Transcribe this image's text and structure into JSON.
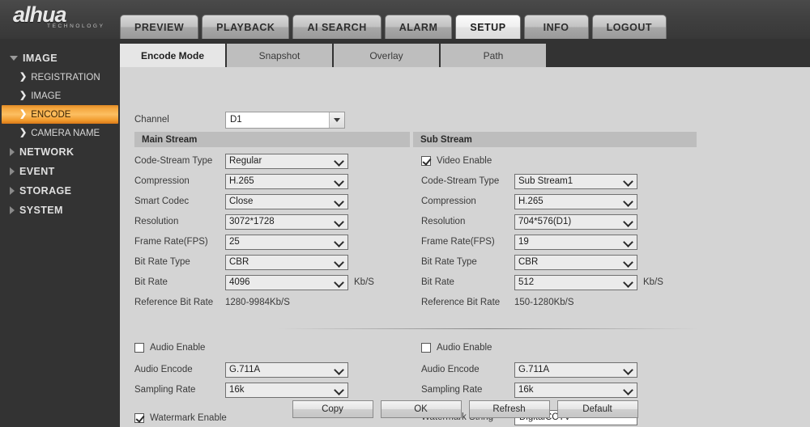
{
  "brand": {
    "name": "alhua",
    "tagline": "TECHNOLOGY"
  },
  "nav": {
    "tabs": [
      {
        "label": "PREVIEW",
        "active": false
      },
      {
        "label": "PLAYBACK",
        "active": false
      },
      {
        "label": "AI SEARCH",
        "active": false
      },
      {
        "label": "ALARM",
        "active": false
      },
      {
        "label": "SETUP",
        "active": true
      },
      {
        "label": "INFO",
        "active": false
      },
      {
        "label": "LOGOUT",
        "active": false
      }
    ]
  },
  "sidebar": {
    "items": [
      {
        "label": "IMAGE",
        "type": "group",
        "expanded": true
      },
      {
        "label": "REGISTRATION",
        "type": "sub",
        "selected": false
      },
      {
        "label": "IMAGE",
        "type": "sub",
        "selected": false
      },
      {
        "label": "ENCODE",
        "type": "sub",
        "selected": true
      },
      {
        "label": "CAMERA NAME",
        "type": "sub",
        "selected": false
      },
      {
        "label": "NETWORK",
        "type": "group",
        "expanded": false
      },
      {
        "label": "EVENT",
        "type": "group",
        "expanded": false
      },
      {
        "label": "STORAGE",
        "type": "group",
        "expanded": false
      },
      {
        "label": "SYSTEM",
        "type": "group",
        "expanded": false
      }
    ]
  },
  "subtabs": [
    {
      "label": "Encode Mode",
      "active": true
    },
    {
      "label": "Snapshot",
      "active": false
    },
    {
      "label": "Overlay",
      "active": false
    },
    {
      "label": "Path",
      "active": false
    }
  ],
  "channel": {
    "label": "Channel",
    "value": "D1"
  },
  "main_stream": {
    "header": "Main Stream",
    "code_stream_type": {
      "label": "Code-Stream Type",
      "value": "Regular"
    },
    "compression": {
      "label": "Compression",
      "value": "H.265"
    },
    "smart_codec": {
      "label": "Smart Codec",
      "value": "Close"
    },
    "resolution": {
      "label": "Resolution",
      "value": "3072*1728"
    },
    "frame_rate": {
      "label": "Frame Rate(FPS)",
      "value": "25"
    },
    "bit_rate_type": {
      "label": "Bit Rate Type",
      "value": "CBR"
    },
    "bit_rate": {
      "label": "Bit Rate",
      "value": "4096",
      "unit": "Kb/S"
    },
    "reference_bit_rate": {
      "label": "Reference Bit Rate",
      "value": "1280-9984Kb/S"
    },
    "audio_enable": {
      "label": "Audio Enable",
      "checked": false
    },
    "audio_encode": {
      "label": "Audio Encode",
      "value": "G.711A"
    },
    "sampling_rate": {
      "label": "Sampling Rate",
      "value": "16k"
    },
    "watermark_enable": {
      "label": "Watermark Enable",
      "checked": true
    }
  },
  "sub_stream": {
    "header": "Sub Stream",
    "video_enable": {
      "label": "Video Enable",
      "checked": true
    },
    "code_stream_type": {
      "label": "Code-Stream Type",
      "value": "Sub Stream1"
    },
    "compression": {
      "label": "Compression",
      "value": "H.265"
    },
    "resolution": {
      "label": "Resolution",
      "value": "704*576(D1)"
    },
    "frame_rate": {
      "label": "Frame Rate(FPS)",
      "value": "19"
    },
    "bit_rate_type": {
      "label": "Bit Rate Type",
      "value": "CBR"
    },
    "bit_rate": {
      "label": "Bit Rate",
      "value": "512",
      "unit": "Kb/S"
    },
    "reference_bit_rate": {
      "label": "Reference Bit Rate",
      "value": "150-1280Kb/S"
    },
    "audio_enable": {
      "label": "Audio Enable",
      "checked": false
    },
    "audio_encode": {
      "label": "Audio Encode",
      "value": "G.711A"
    },
    "sampling_rate": {
      "label": "Sampling Rate",
      "value": "16k"
    },
    "watermark_string": {
      "label": "Watermark String",
      "value": "DigitalCCTV"
    }
  },
  "buttons": [
    {
      "label": "Copy"
    },
    {
      "label": "OK"
    },
    {
      "label": "Refresh"
    },
    {
      "label": "Default"
    }
  ],
  "colors": {
    "accent": "#f5a83f",
    "sidebar_bg": "#333333",
    "content_bg": "#d4d4d4",
    "section_bar": "#bdbdbd"
  }
}
